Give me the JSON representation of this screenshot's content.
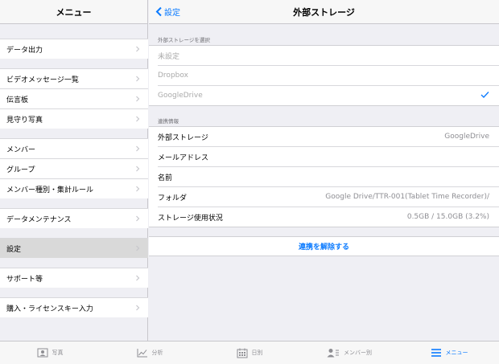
{
  "sidebar": {
    "title": "メニュー",
    "items": [
      {
        "label": "データ出力"
      },
      {
        "label": "ビデオメッセージ一覧"
      },
      {
        "label": "伝言板"
      },
      {
        "label": "見守り写真"
      },
      {
        "label": "メンバー"
      },
      {
        "label": "グループ"
      },
      {
        "label": "メンバー種別・集計ルール"
      },
      {
        "label": "データメンテナンス"
      },
      {
        "label": "設定",
        "selected": true
      },
      {
        "label": "サポート等"
      },
      {
        "label": "購入・ライセンスキー入力"
      }
    ]
  },
  "header": {
    "back_label": "設定",
    "title": "外部ストレージ"
  },
  "storage_select": {
    "heading": "外部ストレージを選択",
    "options": [
      {
        "label": "未設定",
        "checked": false
      },
      {
        "label": "Dropbox",
        "checked": false
      },
      {
        "label": "GoogleDrive",
        "checked": true
      }
    ]
  },
  "link_info": {
    "heading": "連携情報",
    "rows": [
      {
        "label": "外部ストレージ",
        "value": "GoogleDrive"
      },
      {
        "label": "メールアドレス",
        "value": ""
      },
      {
        "label": "名前",
        "value": ""
      },
      {
        "label": "フォルダ",
        "value": "Google Drive/TTR-001(Tablet Time Recorder)/"
      },
      {
        "label": "ストレージ使用状況",
        "value": "0.5GB / 15.0GB (3.2%)"
      }
    ]
  },
  "unlink_label": "連携を解除する",
  "tabbar": {
    "tabs": [
      {
        "label": "写真",
        "icon": "photo-icon"
      },
      {
        "label": "分析",
        "icon": "chart-icon"
      },
      {
        "label": "日別",
        "icon": "calendar-icon"
      },
      {
        "label": "メンバー別",
        "icon": "member-icon"
      },
      {
        "label": "メニュー",
        "icon": "menu-icon",
        "active": true
      }
    ]
  },
  "colors": {
    "accent": "#0a7aff",
    "background": "#efeff4",
    "separator": "#c8c7cc",
    "selected_row": "#d9d9d9"
  }
}
